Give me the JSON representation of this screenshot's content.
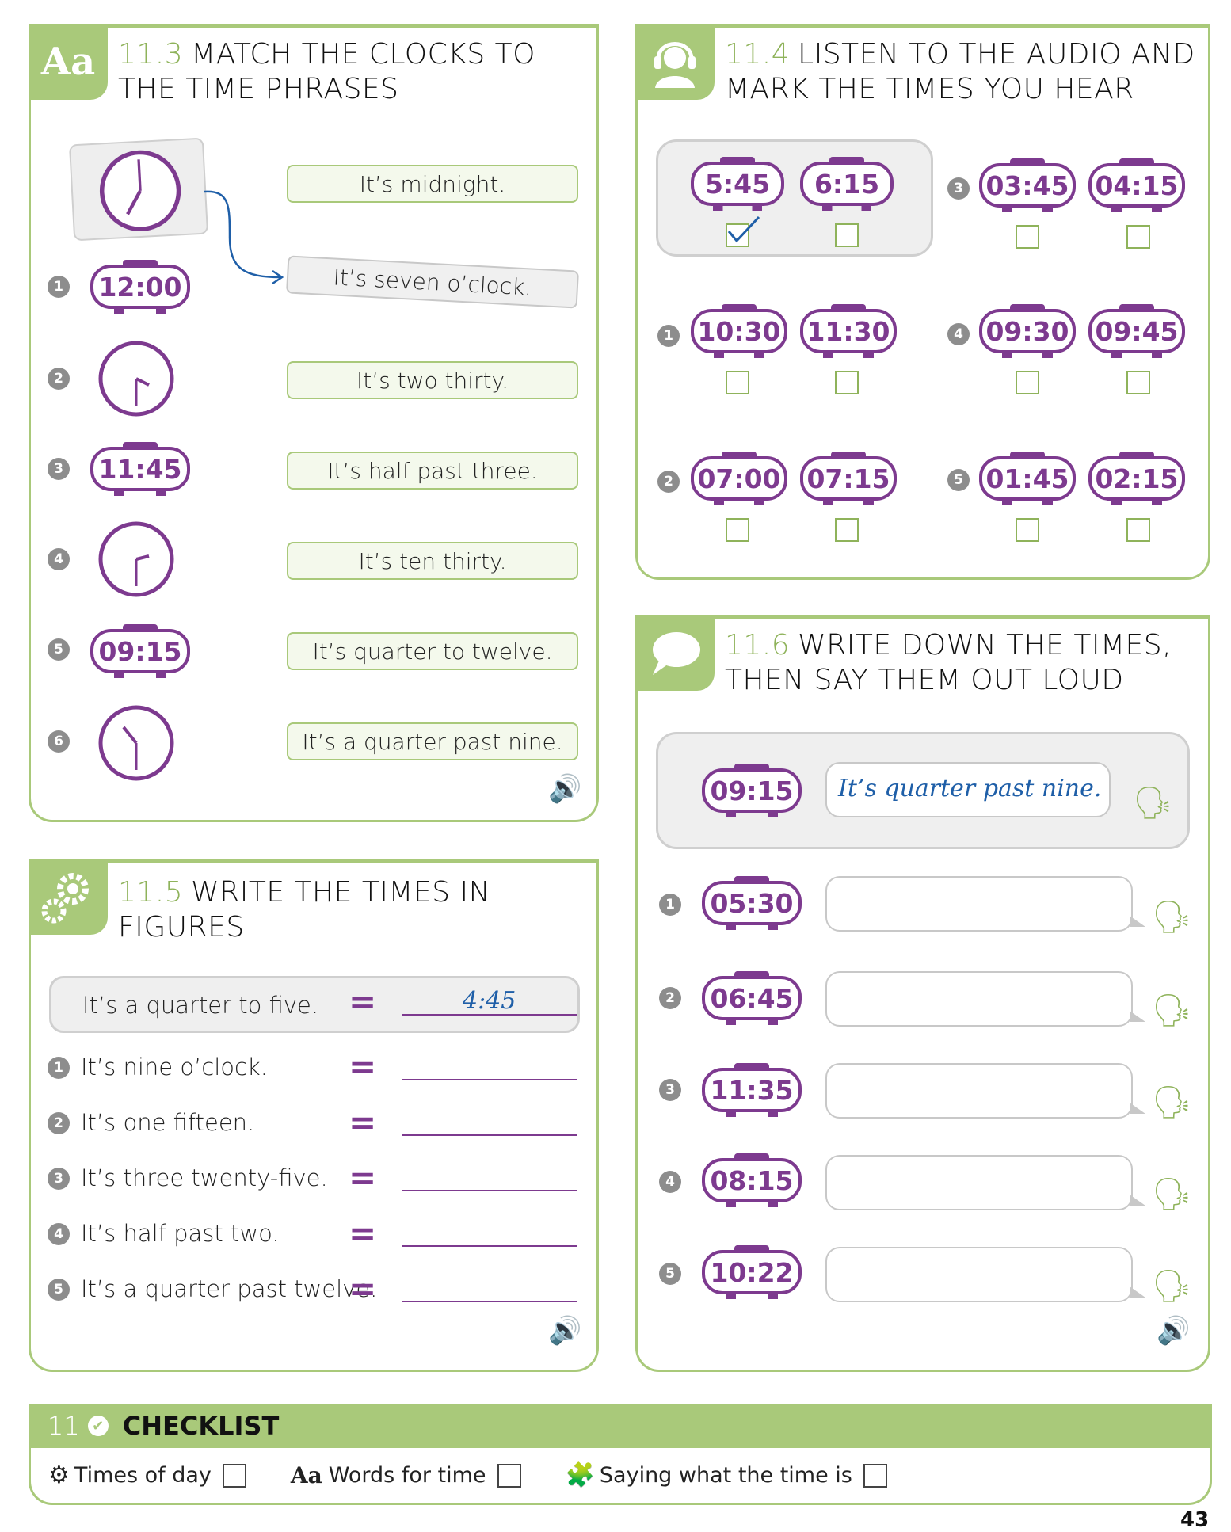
{
  "s113": {
    "num": "11.3",
    "title_l1": "MATCH THE CLOCKS TO",
    "title_l2": "THE TIME PHRASES",
    "badge": "Aa",
    "numbers": [
      "1",
      "2",
      "3",
      "4",
      "5",
      "6"
    ],
    "digital": {
      "r1": "12:00",
      "r3": "11:45",
      "r5": "09:15"
    },
    "phrases": [
      "It’s midnight.",
      "It’s seven o’clock.",
      "It’s two thirty.",
      "It’s half past three.",
      "It’s ten thirty.",
      "It’s quarter to twelve.",
      "It’s a quarter past nine."
    ]
  },
  "s114": {
    "num": "11.4",
    "title_l1": "LISTEN TO THE AUDIO AND",
    "title_l2": "MARK THE TIMES YOU HEAR",
    "example": [
      "5:45",
      "6:15"
    ],
    "items": [
      {
        "n": "1",
        "a": "10:30",
        "b": "11:30"
      },
      {
        "n": "2",
        "a": "07:00",
        "b": "07:15"
      },
      {
        "n": "3",
        "a": "03:45",
        "b": "04:15"
      },
      {
        "n": "4",
        "a": "09:30",
        "b": "09:45"
      },
      {
        "n": "5",
        "a": "01:45",
        "b": "02:15"
      }
    ]
  },
  "s115": {
    "num": "11.5",
    "title": "WRITE THE TIMES IN FIGURES",
    "example_text": "It’s a quarter to five.",
    "example_answer": "4:45",
    "eq": "=",
    "rows": [
      {
        "n": "1",
        "text": "It’s nine o’clock."
      },
      {
        "n": "2",
        "text": "It’s one fifteen."
      },
      {
        "n": "3",
        "text": "It’s three twenty-five."
      },
      {
        "n": "4",
        "text": "It’s half past two."
      },
      {
        "n": "5",
        "text": "It’s a quarter past twelve."
      }
    ]
  },
  "s116": {
    "num": "11.6",
    "title_l1": "WRITE DOWN THE TIMES,",
    "title_l2": "THEN SAY THEM OUT LOUD",
    "example_time": "09:15",
    "example_answer": "It’s quarter past nine.",
    "items": [
      {
        "n": "1",
        "time": "05:30"
      },
      {
        "n": "2",
        "time": "06:45"
      },
      {
        "n": "3",
        "time": "11:35"
      },
      {
        "n": "4",
        "time": "08:15"
      },
      {
        "n": "5",
        "time": "10:22"
      }
    ]
  },
  "checklist": {
    "unit": "11",
    "title": "CHECKLIST",
    "items": [
      "Times of day",
      "Words for time",
      "Saying what the time is"
    ],
    "aa": "Aa"
  },
  "page_number": "43",
  "colors": {
    "green": "#a9c97a",
    "purple": "#7d3a8f",
    "blue": "#1f5fa8"
  },
  "icons": [
    "speaker-icon",
    "headphones-icon",
    "speech-bubble-icon",
    "gears-icon",
    "speaking-head-icon",
    "puzzle-icon",
    "checkmark-icon"
  ]
}
